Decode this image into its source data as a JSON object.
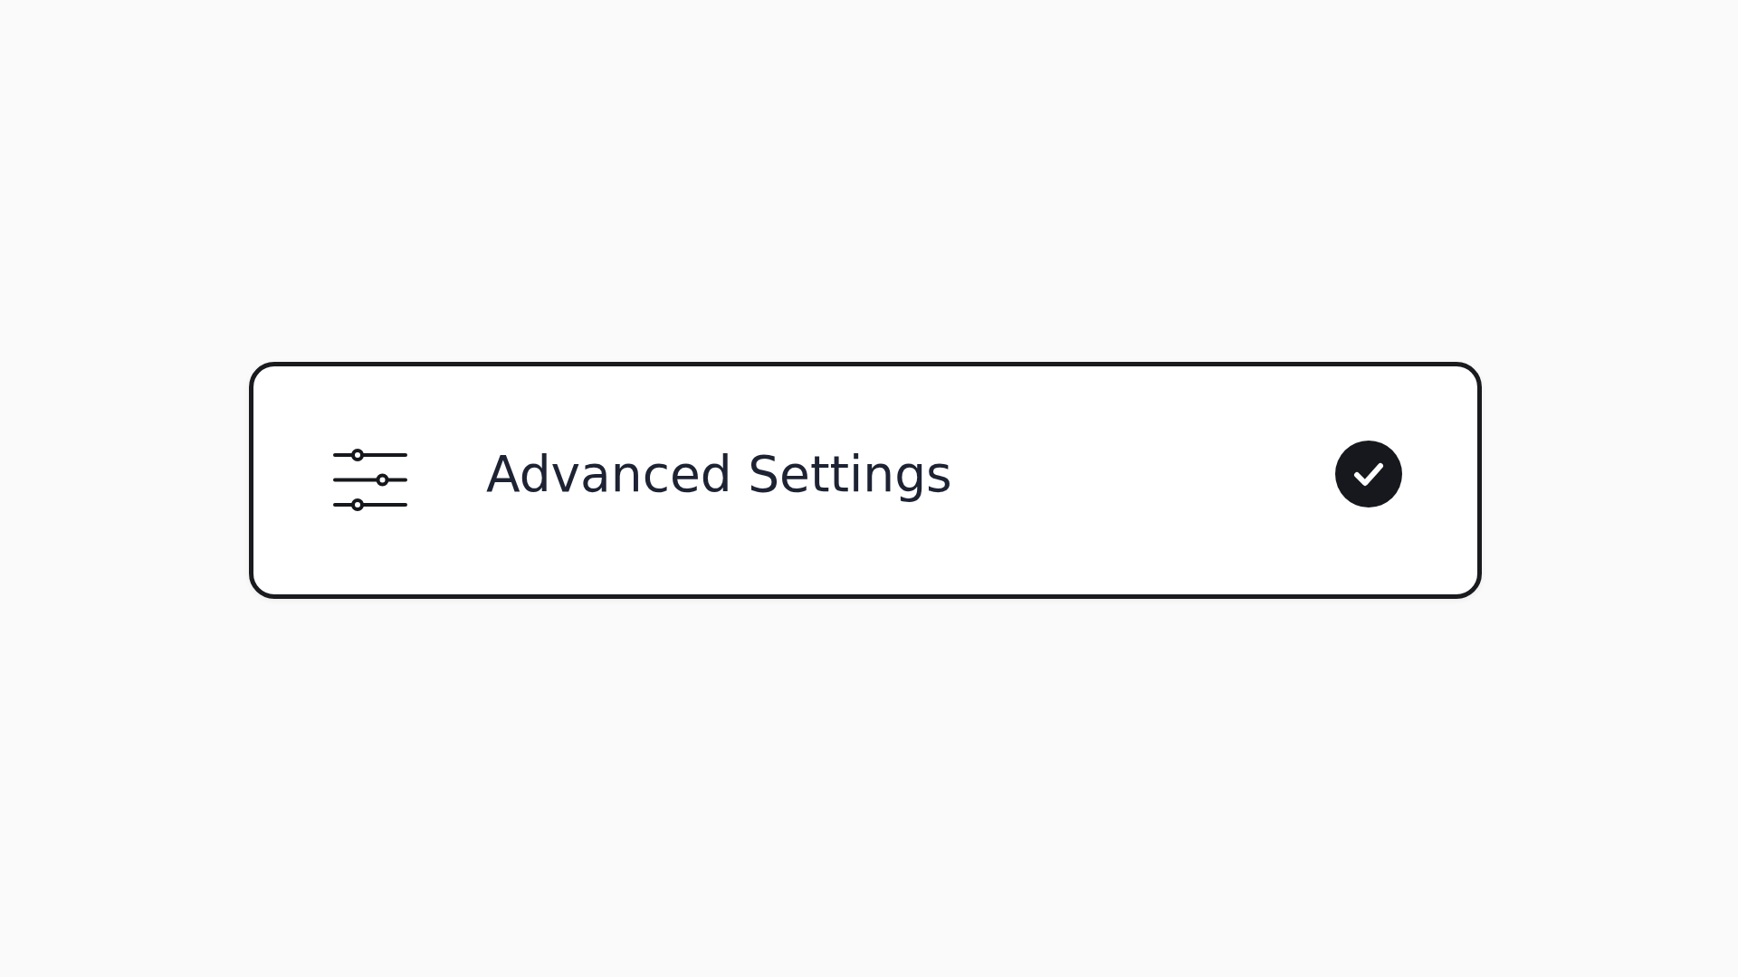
{
  "option": {
    "label": "Advanced Settings",
    "checked": true
  }
}
